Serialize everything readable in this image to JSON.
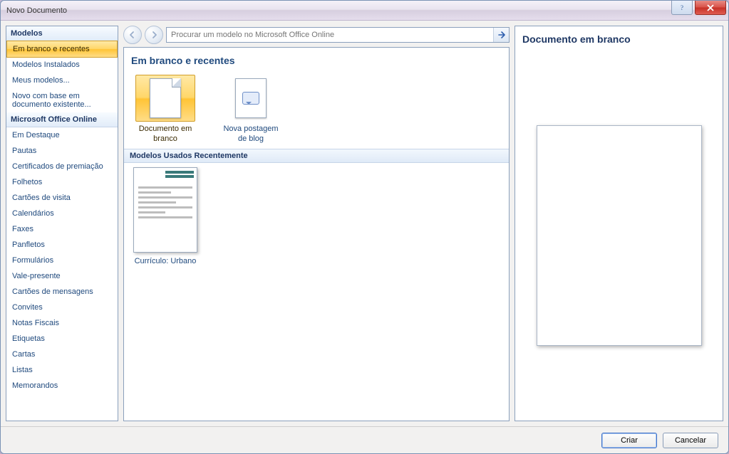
{
  "window": {
    "title": "Novo Documento"
  },
  "sidebar": {
    "headers": {
      "templates": "Modelos",
      "online": "Microsoft Office Online"
    },
    "section_templates": [
      {
        "label": "Em branco e recentes",
        "selected": true
      },
      {
        "label": "Modelos Instalados"
      },
      {
        "label": "Meus modelos..."
      },
      {
        "label": "Novo com base em documento existente..."
      }
    ],
    "section_online": [
      {
        "label": "Em Destaque"
      },
      {
        "label": "Pautas"
      },
      {
        "label": "Certificados de premiação"
      },
      {
        "label": "Folhetos"
      },
      {
        "label": "Cartões de visita"
      },
      {
        "label": "Calendários"
      },
      {
        "label": "Faxes"
      },
      {
        "label": "Panfletos"
      },
      {
        "label": "Formulários"
      },
      {
        "label": "Vale-presente"
      },
      {
        "label": "Cartões de mensagens"
      },
      {
        "label": "Convites"
      },
      {
        "label": "Notas Fiscais"
      },
      {
        "label": "Etiquetas"
      },
      {
        "label": "Cartas"
      },
      {
        "label": "Listas"
      },
      {
        "label": "Memorandos"
      }
    ]
  },
  "search": {
    "placeholder": "Procurar um modelo no Microsoft Office Online"
  },
  "center": {
    "section_title": "Em branco e recentes",
    "tiles": [
      {
        "label": "Documento em branco",
        "icon": "blank-doc",
        "selected": true
      },
      {
        "label": "Nova postagem de blog",
        "icon": "blog-post"
      }
    ],
    "recent_header": "Modelos Usados Recentemente",
    "recent": [
      {
        "label": "Currículo: Urbano"
      }
    ]
  },
  "preview": {
    "title": "Documento em branco"
  },
  "footer": {
    "create": "Criar",
    "cancel": "Cancelar"
  }
}
